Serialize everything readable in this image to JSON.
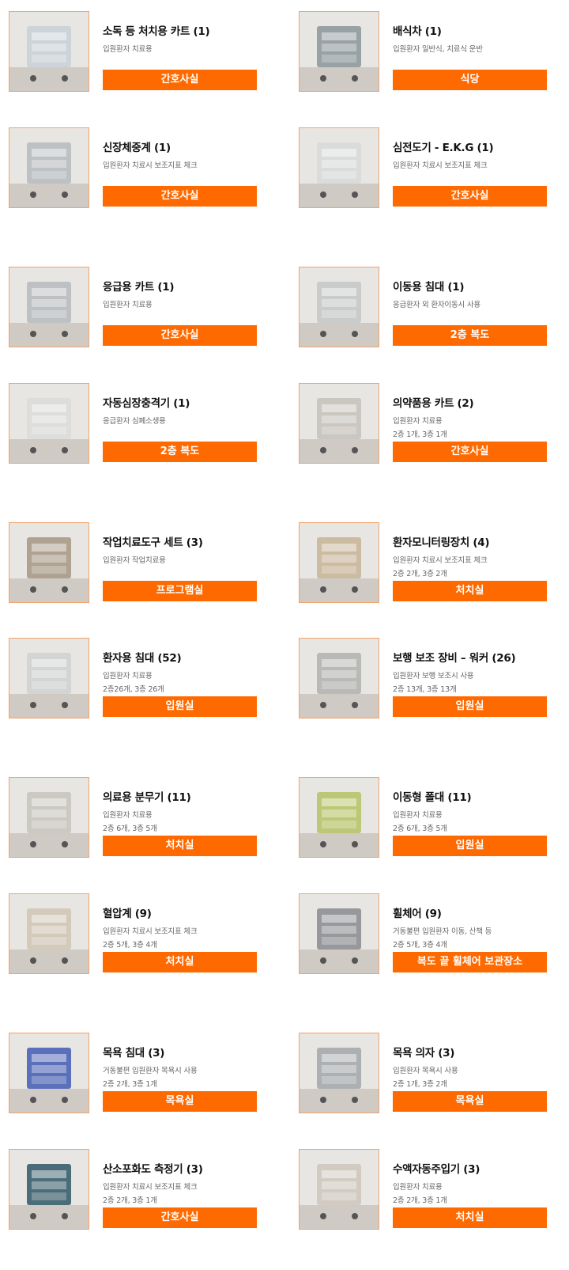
{
  "items": [
    {
      "title": "소독 등 처치용 카트 (1)",
      "desc": "입원환자 치료용",
      "floors": "",
      "location": "간호사실",
      "image": "cart-photo",
      "tone": "#c9d2d8"
    },
    {
      "title": "배식차 (1)",
      "desc": "입원환자 일반식, 치료식 운반",
      "floors": "",
      "location": "식당",
      "image": "meal-cart-photo",
      "tone": "#8f9a9e"
    },
    {
      "title": "신장체중계 (1)",
      "desc": "입원환자 치료시 보조지표 체크",
      "floors": "",
      "location": "간호사실",
      "image": "scale-photo",
      "tone": "#b8bcc0"
    },
    {
      "title": "심전도기 - E.K.G (1)",
      "desc": "입원환자 치료시 보조지표 체크",
      "floors": "",
      "location": "간호사실",
      "image": "ekg-photo",
      "tone": "#d8dadc"
    },
    {
      "title": "응급용 카트 (1)",
      "desc": "입원환자 치료용",
      "floors": "",
      "location": "간호사실",
      "image": "emergency-cart-photo",
      "tone": "#b9bcc1"
    },
    {
      "title": "이동용 침대 (1)",
      "desc": "응급환자 외 환자이동시 사용",
      "floors": "",
      "location": "2층 복도",
      "image": "stretcher-photo",
      "tone": "#c7c9ca"
    },
    {
      "title": "자동심장충격기 (1)",
      "desc": "응급환자 심폐소생용",
      "floors": "",
      "location": "2층 복도",
      "image": "aed-photo",
      "tone": "#dcdcda"
    },
    {
      "title": "의약품용 카트 (2)",
      "desc": "입원환자 치료용",
      "floors": "2층 1개, 3층 1개",
      "location": "간호사실",
      "image": "medicine-cart-photo",
      "tone": "#c6c2bc"
    },
    {
      "title": "작업치료도구 세트 (3)",
      "desc": "입원환자 작업치료용",
      "floors": "",
      "location": "프로그램실",
      "image": "ot-set-photo",
      "tone": "#a89a88"
    },
    {
      "title": "환자모니터링장치 (4)",
      "desc": "입원환자 치료시 보조지표 체크",
      "floors": "2층 2개, 3층 2개",
      "location": "처치실",
      "image": "monitor-photo",
      "tone": "#c8b69a"
    },
    {
      "title": "환자용 침대 (52)",
      "desc": "입원환자 치료용",
      "floors": "2층26개, 3층 26개",
      "location": "입원실",
      "image": "bed-photo",
      "tone": "#cfd3d2"
    },
    {
      "title": "보행 보조 장비 – 워커 (26)",
      "desc": "입원환자 보행 보조시 사용",
      "floors": "2층 13개, 3층 13개",
      "location": "입원실",
      "image": "walker-photo",
      "tone": "#b4b5b2"
    },
    {
      "title": "의료용 분무기 (11)",
      "desc": "입원환자 치료용",
      "floors": "2층 6개, 3층 5개",
      "location": "처치실",
      "image": "nebulizer-photo",
      "tone": "#c9c5c0"
    },
    {
      "title": "이동형 폴대 (11)",
      "desc": "입원환자 치료용",
      "floors": "2층 6개, 3층 5개",
      "location": "입원실",
      "image": "iv-pole-photo",
      "tone": "#b8c46a"
    },
    {
      "title": "혈압계 (9)",
      "desc": "입원환자 치료시 보조지표 체크",
      "floors": "2층 5개, 3층 4개",
      "location": "처치실",
      "image": "bp-monitor-photo",
      "tone": "#d2c7b6"
    },
    {
      "title": "휠체어 (9)",
      "desc": "거동불편 입원환자 이동, 산책 등",
      "floors": "2층 5개, 3층 4개",
      "location": "복도 끝 휠체어 보관장소",
      "image": "wheelchair-photo",
      "tone": "#8d8f93"
    },
    {
      "title": "목욕 침대 (3)",
      "desc": "거동불편 입원환자 목욕시 사용",
      "floors": "2층 2개, 3층 1개",
      "location": "목욕실",
      "image": "bath-bed-photo",
      "tone": "#4a63b7"
    },
    {
      "title": "목욕 의자 (3)",
      "desc": "입원환자 목욕시 사용",
      "floors": "2층 1개, 3층 2개",
      "location": "목욕실",
      "image": "bath-chair-photo",
      "tone": "#a6aaad"
    },
    {
      "title": "산소포화도 측정기 (3)",
      "desc": "입원환자 치료시 보조지표 체크",
      "floors": "2층 2개, 3층 1개",
      "location": "간호사실",
      "image": "oximeter-photo",
      "tone": "#3a5f6f"
    },
    {
      "title": "수액자동주입기 (3)",
      "desc": "입원환자 치료용",
      "floors": "2층 2개, 3층 1개",
      "location": "처치실",
      "image": "infusion-pump-photo",
      "tone": "#cfc8bf"
    }
  ]
}
